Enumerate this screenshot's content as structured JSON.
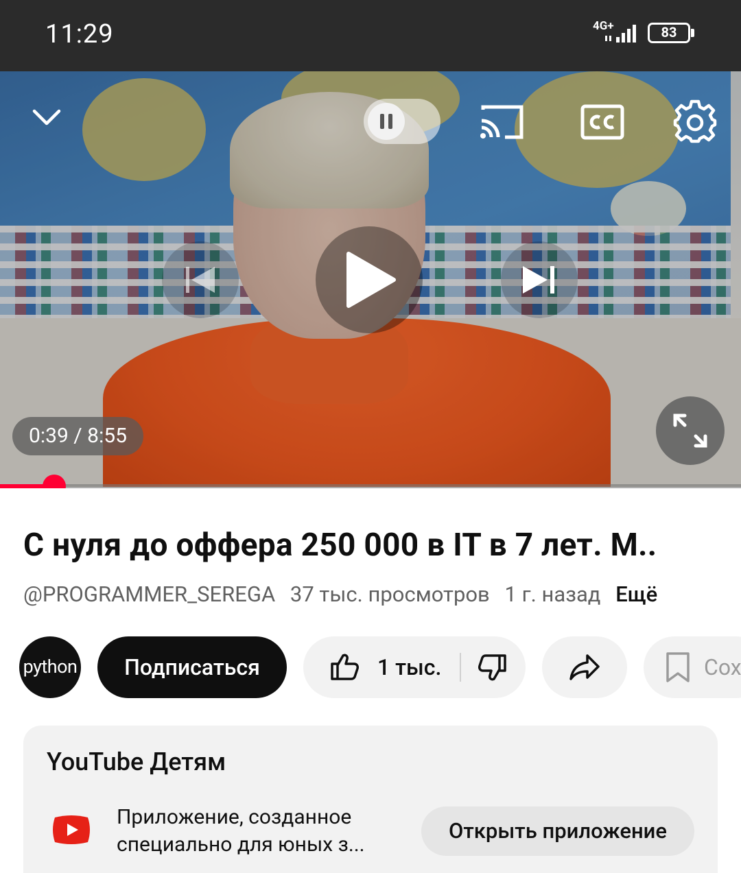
{
  "status_bar": {
    "time": "11:29",
    "network": "4G+",
    "battery": "83"
  },
  "player": {
    "time_display": "0:39 / 8:55",
    "progress_fraction": 0.0735,
    "accent_color": "#ff0033",
    "icons": [
      "chevron-down-icon",
      "pause-icon",
      "cast-icon",
      "captions-icon",
      "settings-icon",
      "previous-icon",
      "play-icon",
      "next-icon",
      "fullscreen-icon"
    ]
  },
  "video": {
    "title": "С нуля до оффера 250 000 в IT в 7 лет. М..",
    "channel": "@PROGRAMMER_SEREGA",
    "views": "37 тыс. просмотров",
    "age": "1 г. назад",
    "more": "Ещё"
  },
  "actions": {
    "avatar_text": "python",
    "subscribe": "Подписаться",
    "likes": "1 тыс.",
    "save": "Сохранить"
  },
  "kids_promo": {
    "title": "YouTube Детям",
    "description_line1": "Приложение, созданное",
    "description_line2": "специально для юных з...",
    "button": "Открыть приложение"
  }
}
